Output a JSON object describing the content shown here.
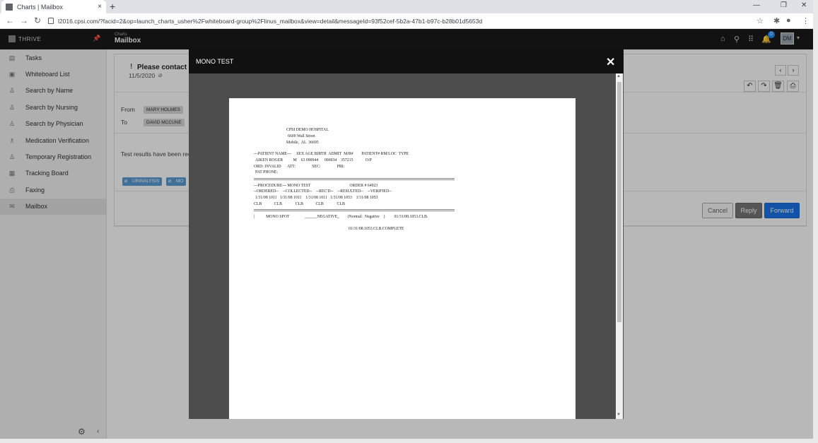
{
  "browser": {
    "tab_title": "Charts | Mailbox",
    "new_tab": "+",
    "close_tab": "×",
    "url": "l2016.cpsi.com/?facid=2&op=launch_charts_usher%2Fwhiteboard-group%2Flinus_mailbox&view=detail&messageId=93f52cef-5b2a-47b1-b97c-b28b01d5653d"
  },
  "app": {
    "brand": "THRIVE",
    "header_sub": "Charts",
    "header_title": "Mailbox",
    "notification_count": "0",
    "user_initials": "DM"
  },
  "sidebar": {
    "items": [
      {
        "label": "Tasks",
        "icon": "tasks-icon"
      },
      {
        "label": "Whiteboard List",
        "icon": "whiteboard-icon"
      },
      {
        "label": "Search by Name",
        "icon": "person-search-icon"
      },
      {
        "label": "Search by Nursing",
        "icon": "person-search-icon"
      },
      {
        "label": "Search by Physician",
        "icon": "person-search-icon"
      },
      {
        "label": "Medication Verification",
        "icon": "medication-icon"
      },
      {
        "label": "Temporary Registration",
        "icon": "registration-icon"
      },
      {
        "label": "Tracking Board",
        "icon": "tracking-icon"
      },
      {
        "label": "Faxing",
        "icon": "fax-icon"
      },
      {
        "label": "Mailbox",
        "icon": "mailbox-icon"
      }
    ]
  },
  "message": {
    "priority": "!",
    "subject": "Please contact pat",
    "date": "11/5/2020",
    "from_label": "From",
    "from": "MARY HOLMES",
    "to_label": "To",
    "to": "DAVID MCCUNE",
    "body": "Test results have been rec",
    "attachments": [
      "URINALYSIS",
      "MO"
    ]
  },
  "actions": {
    "cancel": "Cancel",
    "reply": "Reply",
    "forward": "Forward"
  },
  "modal": {
    "title": "MONO TEST",
    "report": {
      "hospital": "CPSI DEMO HOSPITAL",
      "street": "6600 Wall Street",
      "city": "Mobile,  AL  36695",
      "patient_header": "---PATIENT NAME---     SEX AGE BIRTH  ADMIT  M/R#        PATIENT# RM/LOC  TYPE",
      "patient_row": "AIKEN ROGER          M    63 090944      000034    357215            O/P",
      "ord_row": "ORD: INVALID      ATT:                SEC:                PRI:",
      "phone_row": "PAT PHONE:",
      "procedure_row": "---PROCEDURE--- MONO TEST                                      ORDER # 64923",
      "columns_row": "--ORDERED--    --COLLECTED--    --REC'D--    --RESULTED--    --VERIFIED--",
      "dates_row": "1/31/08 1011   1/31/08 1011    1/31/08 1011   1/31/08 1053    1/31/08 1053",
      "clb_row": "CLB            CLB             CLB            CLB             CLB",
      "result_row": "|           MONO SPOT               ______NEGATIVE_        (Normal:  Negative    )         01/31/08.1053.CLB.",
      "complete_row": "01/31/08.1053.CLB.COMPLETE"
    }
  }
}
